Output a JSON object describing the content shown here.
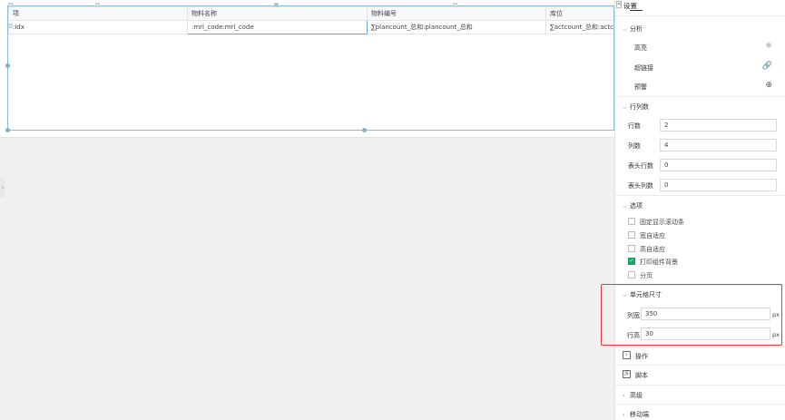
{
  "table": {
    "header": [
      "项",
      "物料名称",
      "物料编号",
      "库位"
    ],
    "row": [
      ":idx",
      ":mrl_code:mrl_code",
      "∑plancount_总和:plancount_总和",
      "∑actcount_总和:actcount_总和"
    ]
  },
  "panel": {
    "title": "设置",
    "toggle": "<",
    "analysis": {
      "title": "分析",
      "items": [
        {
          "label": "高亮",
          "icon": "sun-icon"
        },
        {
          "label": "超链接",
          "icon": "link-icon"
        },
        {
          "label": "预警",
          "icon": "plus-circle-icon"
        }
      ]
    },
    "rowcol": {
      "title": "行列数",
      "fields": [
        {
          "label": "行数",
          "value": "2"
        },
        {
          "label": "列数",
          "value": "4"
        },
        {
          "label": "表头行数",
          "value": "0"
        },
        {
          "label": "表头列数",
          "value": "0"
        }
      ]
    },
    "options": {
      "title": "选项",
      "items": [
        {
          "label": "固定显示滚动条",
          "checked": false
        },
        {
          "label": "宽自适应",
          "checked": false
        },
        {
          "label": "高自适应",
          "checked": false
        },
        {
          "label": "打印组件背景",
          "checked": true
        },
        {
          "label": "分页",
          "checked": false
        }
      ]
    },
    "cellsize": {
      "title": "单元格尺寸",
      "width_label": "列宽",
      "width_value": "350",
      "height_label": "行高",
      "height_value": "30",
      "unit": "px"
    },
    "actions": [
      {
        "label": "操作",
        "icon": "search-icon"
      },
      {
        "label": "脚本",
        "icon": "script-icon",
        "glyph": "JS"
      }
    ],
    "collapsed": [
      {
        "label": "高级"
      },
      {
        "label": "移动端"
      }
    ]
  },
  "colors": {
    "accent": "#1aa262",
    "highlight": "#e53935",
    "selection": "#8fbcd6"
  }
}
